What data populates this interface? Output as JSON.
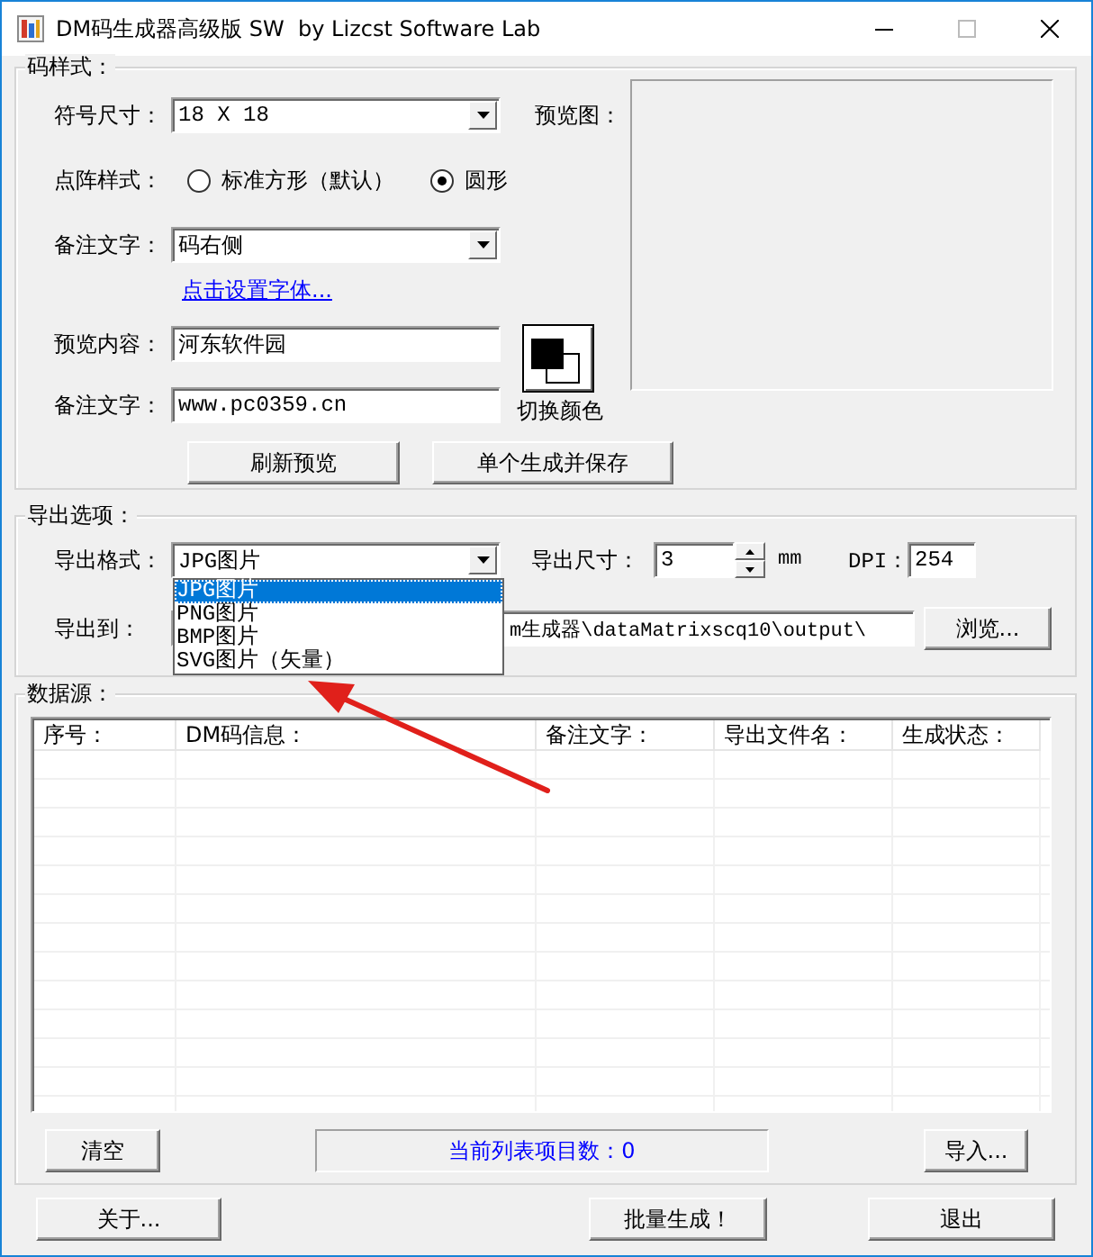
{
  "window": {
    "title": "DM码生成器高级版 SW  by Lizcst Software Lab"
  },
  "style_group": {
    "title": "码样式：",
    "symbol_size": {
      "label": "符号尺寸：",
      "value": "18 X 18"
    },
    "preview_label": "预览图：",
    "dot_style": {
      "label": "点阵样式：",
      "options": [
        {
          "label": "标准方形（默认）",
          "selected": false
        },
        {
          "label": "圆形",
          "selected": true
        }
      ]
    },
    "note_position": {
      "label": "备注文字：",
      "value": "码右侧"
    },
    "font_link": "点击设置字体...",
    "preview_content": {
      "label": "预览内容：",
      "value": "河东软件园"
    },
    "note_text": {
      "label": "备注文字：",
      "value": "www.pc0359.cn"
    },
    "color_button": {
      "label": "切换颜色"
    },
    "buttons": [
      "刷新预览",
      "单个生成并保存"
    ]
  },
  "export_group": {
    "title": "导出选项：",
    "format": {
      "label": "导出格式：",
      "value": "JPG图片",
      "expanded": true,
      "options": [
        {
          "label": "JPG图片",
          "selected": true
        },
        {
          "label": "PNG图片",
          "selected": false
        },
        {
          "label": "BMP图片",
          "selected": false
        },
        {
          "label": "SVG图片（矢量）",
          "selected": false
        }
      ]
    },
    "size": {
      "label": "导出尺寸：",
      "value": "3",
      "unit": "mm"
    },
    "dpi": {
      "label": "DPI：",
      "value": "254"
    },
    "destination": {
      "label": "导出到：",
      "value": "m生成器\\dataMatrixscq10\\output\\"
    },
    "browse_button": "浏览..."
  },
  "data_group": {
    "title": "数据源：",
    "table": {
      "columns": [
        "序号：",
        "DM码信息：",
        "备注文字：",
        "导出文件名：",
        "生成状态："
      ]
    },
    "clear_button": "清空",
    "status": "当前列表项目数：0",
    "import_button": "导入..."
  },
  "footer_buttons": [
    "关于...",
    "批量生成！",
    "退出"
  ]
}
